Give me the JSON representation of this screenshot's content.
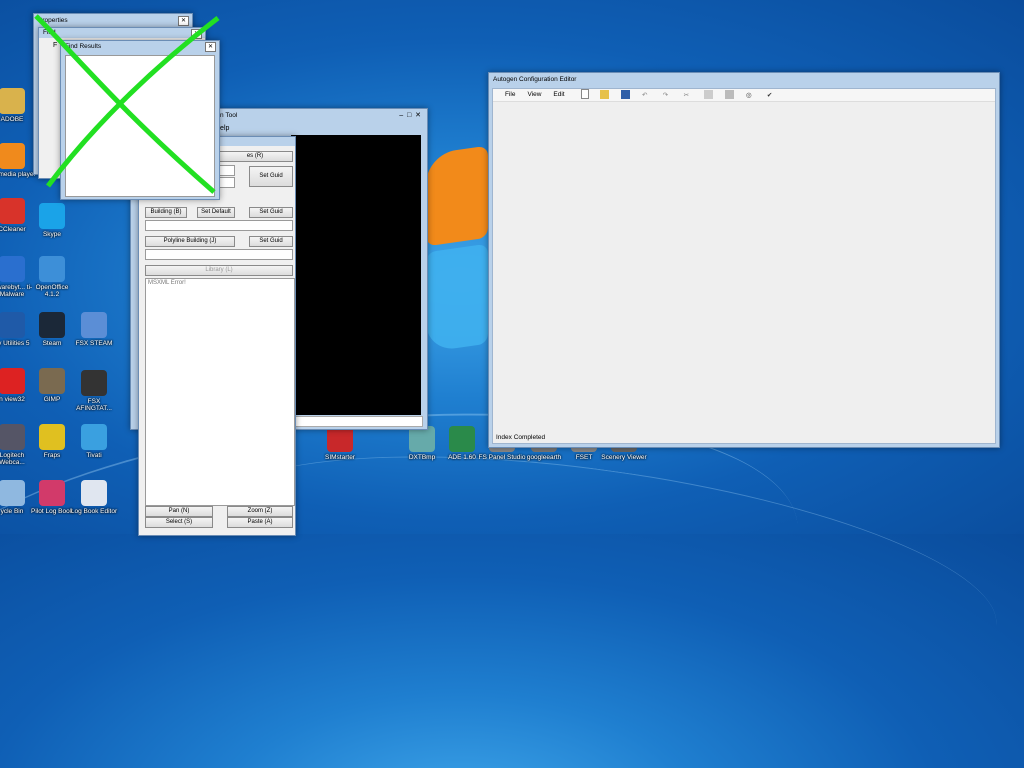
{
  "desktop": {
    "icons": [
      {
        "label": "ADOBE",
        "color": "#d9b24c"
      },
      {
        "label": "1C media player",
        "color": "#f08a1c"
      },
      {
        "label": "CCleaner",
        "color": "#d8332a"
      },
      {
        "label": "Skype",
        "color": "#1aa3e8"
      },
      {
        "label": "alwarebyt... ti-Malware",
        "color": "#2a6fcf"
      },
      {
        "label": "OpenOffice 4.1.2",
        "color": "#3d8fd8"
      },
      {
        "label": "ay Utilities 5",
        "color": "#1f5aa8"
      },
      {
        "label": "Steam",
        "color": "#1b2838"
      },
      {
        "label": "FSX STEAM",
        "color": "#5b8ed6"
      },
      {
        "label": "n view32",
        "color": "#d22"
      },
      {
        "label": "GIMP",
        "color": "#7a6a50"
      },
      {
        "label": "FSX AFINGTAT...",
        "color": "#333"
      },
      {
        "label": "Logitech Webca...",
        "color": "#556"
      },
      {
        "label": "Fraps",
        "color": "#e0c020"
      },
      {
        "label": "Tivati",
        "color": "#3aa0e0"
      },
      {
        "label": "ycle Bin",
        "color": "#8fb8e0"
      },
      {
        "label": "Pilot Log Book",
        "color": "#d23a6a"
      },
      {
        "label": "Log Book Editor",
        "color": "#e0e6f0"
      },
      {
        "label": "SIMstarter",
        "color": "#c8282a"
      },
      {
        "label": "DXTBmp",
        "color": "#6aa"
      },
      {
        "label": "ADE 1.60",
        "color": "#2a8a4a"
      },
      {
        "label": "FS Panel Studio",
        "color": "#888"
      },
      {
        "label": "googleearth",
        "color": "#777"
      },
      {
        "label": "FSET",
        "color": "#888"
      },
      {
        "label": "Scenery Viewer",
        "color": "#666"
      }
    ]
  },
  "properties_window": {
    "title": "Properties",
    "sub_title": "Find",
    "sub_label": "F",
    "results_title": "Find Results"
  },
  "tool_window": {
    "title_fragment": "ion Tool",
    "menu_fragment": "Help",
    "left_panel": {
      "row1_label": "es (R)",
      "set_guid_1": "Set Guid",
      "building_label": "Building (B)",
      "set_default_label": "Set Default",
      "set_guid_2": "Set Guid",
      "polyline_label": "Polyline Building (J)",
      "set_guid_3": "Set Guid",
      "library_label": "Library (L)",
      "log_text": "MSXML Error!",
      "pan_label": "Pan (N)",
      "zoom_label": "Zoom (Z)",
      "select_label": "Select (S)",
      "paste_label": "Paste (A)"
    }
  },
  "autogen_window": {
    "title": "Autogen Configuration Editor",
    "menu": [
      "File",
      "View",
      "Edit"
    ],
    "toolbar_icons": [
      "new-icon",
      "open-icon",
      "save-icon",
      "undo-icon",
      "redo-icon",
      "cut-icon",
      "copy-icon",
      "paste-icon",
      "find-icon",
      "check-icon"
    ],
    "status": "Index Completed"
  },
  "colors": {
    "cross": "#22e022",
    "title_bar": "#b9d1ea",
    "client_gray": "#efefef"
  }
}
